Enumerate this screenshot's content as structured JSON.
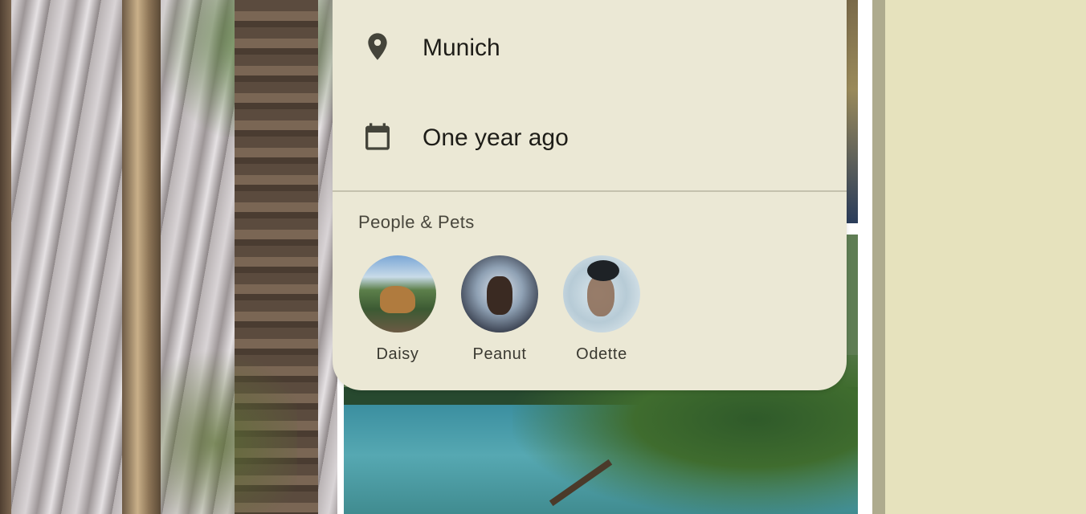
{
  "details": {
    "location": {
      "icon": "location-pin-icon",
      "label": "Munich"
    },
    "date": {
      "icon": "calendar-icon",
      "label": "One year ago"
    }
  },
  "people_section": {
    "title": "People & Pets",
    "people": [
      {
        "name": "Daisy",
        "avatar": "dog-photo"
      },
      {
        "name": "Peanut",
        "avatar": "dog-photo"
      },
      {
        "name": "Odette",
        "avatar": "person-photo"
      }
    ]
  },
  "colors": {
    "sheet_background": "#ebe8d5",
    "right_panel_background": "#e6e2bd",
    "text_primary": "#1e1d18",
    "icon": "#44443a"
  }
}
